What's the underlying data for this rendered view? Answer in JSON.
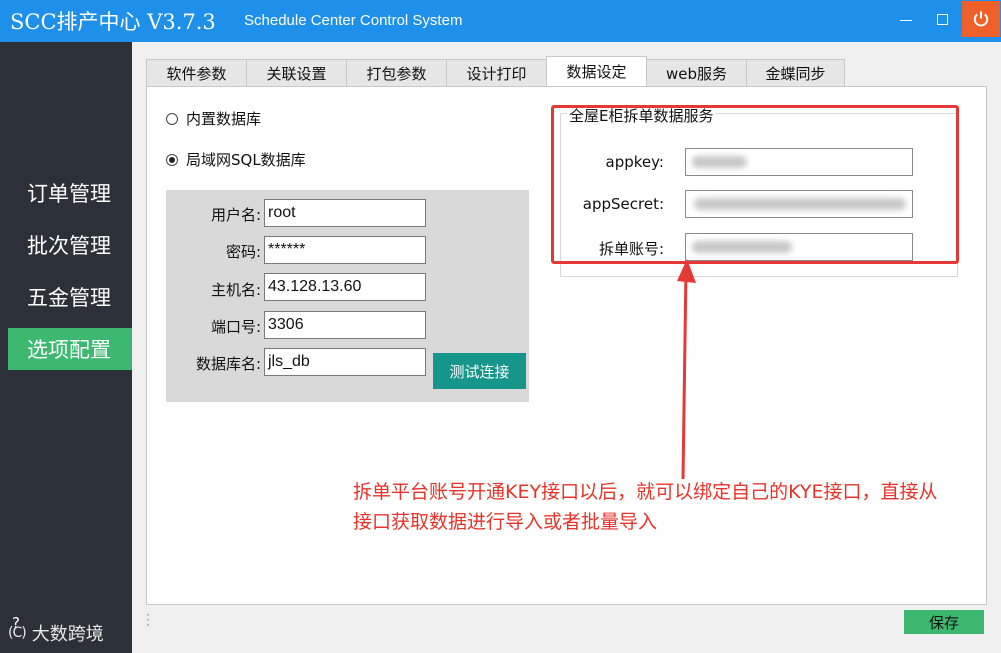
{
  "window": {
    "app_title": "SCC排产中心 V3.7.3",
    "sub_title": "Schedule Center Control System",
    "close_color": "#f0602a",
    "title_color": "#1e90ea"
  },
  "sidebar": {
    "items": [
      {
        "label": "订单管理"
      },
      {
        "label": "批次管理"
      },
      {
        "label": "五金管理"
      },
      {
        "label": "选项配置"
      }
    ],
    "active": "选项配置",
    "help": "?",
    "watermark": "大数跨境",
    "watermark_logo": "(C)"
  },
  "tabs": [
    {
      "label": "软件参数"
    },
    {
      "label": "关联设置"
    },
    {
      "label": "打包参数"
    },
    {
      "label": "设计打印"
    },
    {
      "label": "数据设定"
    },
    {
      "label": "web服务"
    },
    {
      "label": "金蝶同步"
    }
  ],
  "active_tab": "数据设定",
  "db_options": {
    "builtin": "内置数据库",
    "lan_sql": "局域网SQL数据库",
    "selected": "局域网SQL数据库"
  },
  "db_form": {
    "username_label": "用户名:",
    "username": "root",
    "password_label": "密码:",
    "password": "******",
    "host_label": "主机名:",
    "host": "43.128.13.60",
    "port_label": "端口号:",
    "port": "3306",
    "dbname_label": "数据库名:",
    "dbname": "jls_db",
    "test_button": "测试连接"
  },
  "split_service": {
    "title": "全屋E柜拆单数据服务",
    "appkey_label": "appkey:",
    "appsecret_label": "appSecret:",
    "account_label": "拆单账号:"
  },
  "annotation": {
    "line1": "拆单平台账号开通KEY接口以后，就可以绑定自己的KYE接口，直接从",
    "line2": "接口获取数据进行导入或者批量导入",
    "color": "#e8332a"
  },
  "footer": {
    "save_button": "保存"
  }
}
